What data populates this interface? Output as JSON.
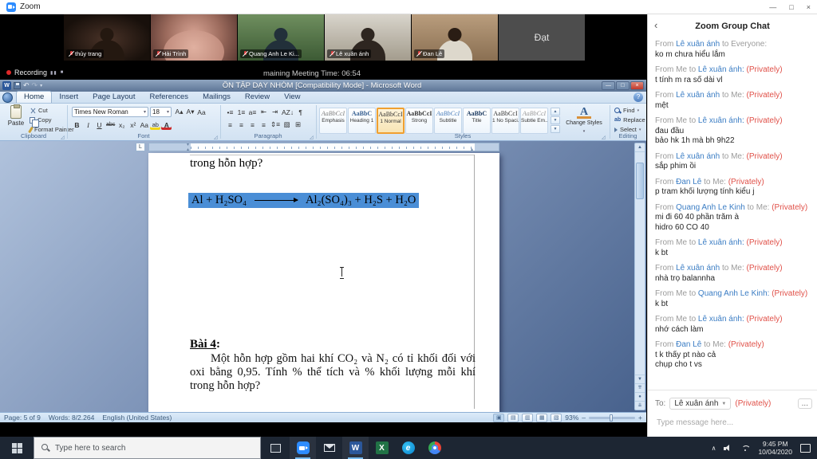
{
  "zoom": {
    "window_title": "Zoom",
    "window_controls": {
      "minimize": "—",
      "maximize": "□",
      "close": "×"
    },
    "recording_label": "Recording",
    "meeting_time": "maining Meeting Time: 06:54",
    "participants": [
      {
        "name": "thủy trang",
        "muted": true,
        "camera_off": false
      },
      {
        "name": "Hải Trình",
        "muted": true,
        "camera_off": false
      },
      {
        "name": "Quang Anh Le Ki...",
        "muted": true,
        "camera_off": false
      },
      {
        "name": "Lê xuân ánh",
        "muted": true,
        "camera_off": false
      },
      {
        "name": "Đan Lê",
        "muted": true,
        "camera_off": false
      },
      {
        "name": "Đạt",
        "muted": false,
        "camera_off": true
      }
    ]
  },
  "word": {
    "title": "ÔN TẬP DẠY NHÓM [Compatibility Mode] - Microsoft Word",
    "window_controls": {
      "minimize": "—",
      "restore": "□",
      "close": "×"
    },
    "help": "?",
    "tabs": [
      {
        "label": "Home",
        "active": true
      },
      {
        "label": "Insert",
        "active": false
      },
      {
        "label": "Page Layout",
        "active": false
      },
      {
        "label": "References",
        "active": false
      },
      {
        "label": "Mailings",
        "active": false
      },
      {
        "label": "Review",
        "active": false
      },
      {
        "label": "View",
        "active": false
      }
    ],
    "clipboard": {
      "label": "Clipboard",
      "paste": "Paste",
      "cut": "Cut",
      "copy": "Copy",
      "format_painter": "Format Painter"
    },
    "font": {
      "label": "Font",
      "family": "Times New Roman",
      "size": "18",
      "row1_buttons": [
        {
          "name": "grow-font-button",
          "glyph": "A▴"
        },
        {
          "name": "shrink-font-button",
          "glyph": "A▾"
        },
        {
          "name": "clear-formatting-button",
          "glyph": "Aa"
        }
      ],
      "row2_buttons": [
        {
          "name": "bold-button",
          "glyph": "B"
        },
        {
          "name": "italic-button",
          "glyph": "I"
        },
        {
          "name": "underline-button",
          "glyph": "U"
        },
        {
          "name": "strikethrough-button",
          "glyph": "abc"
        },
        {
          "name": "subscript-button",
          "glyph": "x₂"
        },
        {
          "name": "superscript-button",
          "glyph": "x²"
        },
        {
          "name": "change-case-button",
          "glyph": "Aa"
        },
        {
          "name": "highlight-button",
          "glyph": "ab"
        },
        {
          "name": "font-color-button",
          "glyph": "A"
        }
      ]
    },
    "paragraph": {
      "label": "Paragraph",
      "row1_buttons": [
        {
          "name": "bullets-button",
          "glyph": "•≡"
        },
        {
          "name": "numbering-button",
          "glyph": "1≡"
        },
        {
          "name": "multilevel-list-button",
          "glyph": "a≡"
        },
        {
          "name": "decrease-indent-button",
          "glyph": "⇤"
        },
        {
          "name": "increase-indent-button",
          "glyph": "⇥"
        },
        {
          "name": "sort-button",
          "glyph": "AZ↓"
        },
        {
          "name": "show-hide-button",
          "glyph": "¶"
        }
      ],
      "row2_buttons": [
        {
          "name": "align-left-button",
          "glyph": "≡"
        },
        {
          "name": "align-center-button",
          "glyph": "≡"
        },
        {
          "name": "align-right-button",
          "glyph": "≡"
        },
        {
          "name": "justify-button",
          "glyph": "≡"
        },
        {
          "name": "line-spacing-button",
          "glyph": "⇕≡"
        },
        {
          "name": "shading-button",
          "glyph": "▨"
        },
        {
          "name": "borders-button",
          "glyph": "⊞"
        }
      ]
    },
    "styles": {
      "label": "Styles",
      "change_styles_label": "Change Styles",
      "gallery": [
        {
          "preview": "AaBbCcI",
          "name": "Emphasis",
          "selected": false
        },
        {
          "preview": "AaBbC",
          "name": "Heading 1",
          "selected": false
        },
        {
          "preview": "AaBbCcI",
          "name": "1 Normal",
          "selected": true
        },
        {
          "preview": "AaBbCcI",
          "name": "Strong",
          "selected": false
        },
        {
          "preview": "AaBbCcI",
          "name": "Subtitle",
          "selected": false
        },
        {
          "preview": "AaBbC",
          "name": "Title",
          "selected": false
        },
        {
          "preview": "AaBbCcI",
          "name": "1 No Spaci...",
          "selected": false
        },
        {
          "preview": "AaBbCcI",
          "name": "Subtle Em...",
          "selected": false
        }
      ]
    },
    "editing": {
      "label": "Editing",
      "find": "Find",
      "replace": "Replace",
      "select": "Select"
    },
    "document": {
      "line_top": "trong hỗn hợp?",
      "equation_lhs": "Al  +  H₂SO₄",
      "equation_rhs": "Al₂(SO₄)₃  +  H₂S  +  H₂O",
      "bai4_label": "Bài 4",
      "bai4_colon": ":",
      "bai4_text": "Một hỗn hợp gồm hai khí CO₂ và N₂ có tỉ khối đối với oxi bằng 0,95. Tính % thể tích và % khối lượng mỗi khí trong hỗn hợp?"
    },
    "status": {
      "page": "Page: 5 of 9",
      "words": "Words: 8/2.264",
      "language": "English (United States)",
      "zoom_level": "93%"
    }
  },
  "chat": {
    "title": "Zoom Group Chat",
    "from_word": "From",
    "to_word": "to",
    "privately_word": "(Privately)",
    "messages": [
      {
        "from": "Lê xuân ánh",
        "to": "Everyone",
        "private": false,
        "lines": [
          "ko m chưa hiểu lắm"
        ]
      },
      {
        "from": "Me",
        "to": "Lê xuân ánh",
        "private": true,
        "lines": [
          "t tính m ra số dài vl"
        ]
      },
      {
        "from": "Lê xuân ánh",
        "to": "Me",
        "private": true,
        "lines": [
          "mệt"
        ]
      },
      {
        "from": "Me",
        "to": "Lê xuân ánh",
        "private": true,
        "lines": [
          "đau đầu",
          "bảo hk 1h mà bh 9h22"
        ]
      },
      {
        "from": "Lê xuân ánh",
        "to": "Me",
        "private": true,
        "lines": [
          "sắp phim ồi"
        ]
      },
      {
        "from": "Đan Lê",
        "to": "Me",
        "private": true,
        "lines": [
          "p tram khối lượng tính kiểu j"
        ]
      },
      {
        "from": "Quang Anh Le Kinh",
        "to": "Me",
        "private": true,
        "lines": [
          "mi đi 60 40 phần trăm à",
          "hidro 60 CO 40"
        ]
      },
      {
        "from": "Me",
        "to": "Lê xuân ánh",
        "private": true,
        "lines": [
          "k bt"
        ]
      },
      {
        "from": "Lê xuân ánh",
        "to": "Me",
        "private": true,
        "lines": [
          "nhà trọ balannha"
        ]
      },
      {
        "from": "Me",
        "to": "Quang Anh Le Kinh",
        "private": true,
        "lines": [
          "k bt"
        ]
      },
      {
        "from": "Me",
        "to": "Lê xuân ánh",
        "private": true,
        "lines": [
          "nhớ cách làm"
        ]
      },
      {
        "from": "Đan Lê",
        "to": "Me",
        "private": true,
        "lines": [
          "t k thấy pt nào cả",
          "chụp cho t vs"
        ]
      }
    ],
    "to_label": "To:",
    "to_value": "Lê xuân ánh",
    "more_button": "...",
    "input_placeholder": "Type message here..."
  },
  "taskbar": {
    "search_placeholder": "Type here to search",
    "apps": [
      "zoom",
      "mail",
      "word",
      "excel",
      "edge",
      "chrome"
    ],
    "tray_time": "9:45 PM",
    "tray_date": "10/04/2020"
  }
}
